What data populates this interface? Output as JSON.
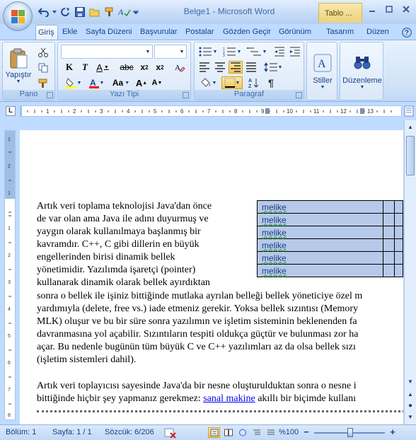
{
  "window": {
    "app_title": "Belge1 - Microsoft Word",
    "context_tab": "Tablo ...",
    "controls": [
      "minimize-icon",
      "maximize-icon",
      "close-icon"
    ]
  },
  "quick_access": [
    "undo-icon",
    "redo-icon",
    "save-icon",
    "open-folder-icon",
    "format-painter-icon",
    "spelling-icon",
    "customize-dropdown-icon"
  ],
  "tabs": [
    {
      "label": "Giriş",
      "active": true
    },
    {
      "label": "Ekle"
    },
    {
      "label": "Sayfa Düzeni"
    },
    {
      "label": "Başvurular"
    },
    {
      "label": "Postalar"
    },
    {
      "label": "Gözden Geçir"
    },
    {
      "label": "Görünüm"
    },
    {
      "label": "Tasarım"
    },
    {
      "label": "Düzen"
    }
  ],
  "ribbon": {
    "groups": {
      "clipboard": {
        "label": "Pano",
        "paste_label": "Yapıştır"
      },
      "font": {
        "label": "Yazı Tipi",
        "font_name": "",
        "font_size": ""
      },
      "paragraph": {
        "label": "Paragraf"
      },
      "styles": {
        "label": "Stiller"
      },
      "editing": {
        "label": "Düzenleme"
      }
    },
    "colors": {
      "highlight": "#ffff00",
      "font_color": "#ff0000"
    }
  },
  "document": {
    "wrap_lines": [
      "Artık veri toplama teknolojisi  Java'dan önce",
      "de var olan ama Java ile adını duyurmuş ve",
      "yaygın olarak kullanılmaya  başlanmış bir",
      "kavramdır. C++, C gibi dillerin en büyük",
      "engellerinden birisi  dinamik bellek",
      "yönetimidir. Yazılımda işaretçi  (pointer)",
      "kullanarak dinamik olarak bellek ayırdıktan"
    ],
    "full_lines": [
      "sonra o bellek ile işiniz bittiğinde mutlaka ayrılan belleği bellek  yöneticiye özel m",
      "yardımıyla (delete, free vs.) iade etmeniz gerekir. Yoksa bellek sızıntısı (Memory",
      "MLK) oluşur ve bu bir süre sonra yazılımın  ve işletim sisteminin beklenenden fa",
      "davranmasına yol açabilir. Sızıntıların tespiti oldukça güçtür ve bulunması  zor ha",
      "açar. Bu nedenle bugünün tüm büyük C ve C++ yazılımları  az da olsa bellek sızı",
      "(işletim sistemleri  dahil)."
    ],
    "para2_line1": "Artık veri toplayıcısı sayesinde Java'da bir nesne oluşturulduktan sonra o nesne i",
    "para2_line2_a": "bittiğinde hiçbir şey yapmanız gerekmez: ",
    "para2_link": "sanal makine",
    "para2_line2_b": " akıllı bir biçimde kullanı",
    "table": {
      "rows": [
        "melike",
        "melike",
        "melike",
        "melike",
        "melike",
        "melike"
      ]
    }
  },
  "statusbar": {
    "section": "Bölüm: 1",
    "page": "Sayfa: 1 / 1",
    "words": "Sözcük: 6/206",
    "zoom": "%100",
    "zoom_percent": 100
  }
}
